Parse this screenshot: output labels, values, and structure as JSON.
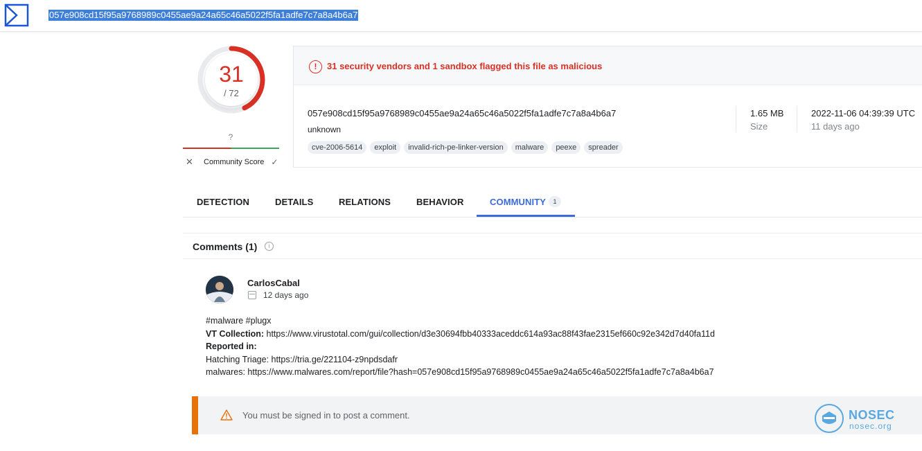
{
  "header": {
    "search_value": "057e908cd15f95a9768989c0455ae9a24a65c46a5022f5fa1adfe7c7a8a4b6a7",
    "logo_icon": "virustotal-sigma-icon"
  },
  "score": {
    "detections": "31",
    "total": "/ 72",
    "ring_fraction": 0.43,
    "ring_color": "#d93025"
  },
  "community_score": {
    "value": "?",
    "label": "Community Score",
    "down_icon": "x-icon",
    "up_icon": "check-icon"
  },
  "alert": {
    "text": "31 security vendors and 1 sandbox flagged this file as malicious",
    "color": "#d93025"
  },
  "file": {
    "hash": "057e908cd15f95a9768989c0455ae9a24a65c46a5022f5fa1adfe7c7a8a4b6a7",
    "name": "unknown",
    "tags": [
      "cve-2006-5614",
      "exploit",
      "invalid-rich-pe-linker-version",
      "malware",
      "peexe",
      "spreader"
    ],
    "size_value": "1.65 MB",
    "size_label": "Size",
    "date_value": "2022-11-06 04:39:39 UTC",
    "date_label": "11 days ago"
  },
  "tabs": [
    {
      "label": "DETECTION"
    },
    {
      "label": "DETAILS"
    },
    {
      "label": "RELATIONS"
    },
    {
      "label": "BEHAVIOR"
    },
    {
      "label": "COMMUNITY",
      "badge": "1",
      "active": true
    }
  ],
  "comments": {
    "title": "Comments (1)",
    "items": [
      {
        "author": "CarlosCabal",
        "age": "12 days ago",
        "hashtags": "#malware #plugx",
        "vt_collection_label": "VT Collection:",
        "vt_collection_url": " https://www.virustotal.com/gui/collection/d3e30694fbb40333aceddc614a93ac88f43fae2315ef660c92e342d7d40fa11d",
        "reported_label": "Reported in:",
        "reported_1": "Hatching Triage: https://tria.ge/221104-z9npdsdafr",
        "reported_2": "malwares: https://www.malwares.com/report/file?hash=057e908cd15f95a9768989c0455ae9a24a65c46a5022f5fa1adfe7c7a8a4b6a7"
      }
    ]
  },
  "signin": {
    "text": "You must be signed in to post a comment.",
    "accent": "#e8710a"
  },
  "watermark": {
    "name": "NOSEC",
    "url": "nosec.org"
  }
}
